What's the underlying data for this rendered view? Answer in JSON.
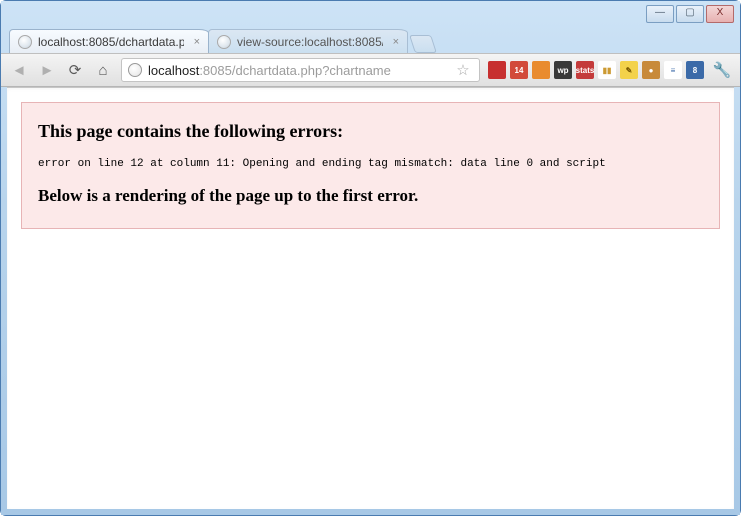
{
  "window": {
    "minimize": "—",
    "maximize": "▢",
    "close": "X"
  },
  "tabs": [
    {
      "title": "localhost:8085/dchartdata.p",
      "active": true
    },
    {
      "title": "view-source:localhost:8085/",
      "active": false
    }
  ],
  "toolbar": {
    "back": "◄",
    "forward": "►",
    "reload": "⟳",
    "home": "⌂",
    "star": "☆",
    "wrench": "🔧"
  },
  "url": {
    "host": "localhost",
    "port": ":8085",
    "path": "/dchartdata.php?chartname"
  },
  "extensions": [
    {
      "name": "ext-red-1",
      "bg": "#c73030",
      "label": ""
    },
    {
      "name": "ext-cal-14",
      "bg": "#d24a3a",
      "label": "14"
    },
    {
      "name": "ext-orange",
      "bg": "#e98b2e",
      "label": ""
    },
    {
      "name": "ext-wait",
      "bg": "#3a3a3a",
      "label": "wp"
    },
    {
      "name": "ext-stats",
      "bg": "#c43b3b",
      "label": "stats"
    },
    {
      "name": "ext-bars",
      "bg": "#ffffff",
      "label": "▮▮",
      "fg": "#cc9a33"
    },
    {
      "name": "ext-yellow",
      "bg": "#f3d24a",
      "label": "✎",
      "fg": "#7a5a00"
    },
    {
      "name": "ext-cookie",
      "bg": "#c88a3a",
      "label": "●"
    },
    {
      "name": "ext-abacus",
      "bg": "#ffffff",
      "label": "≡",
      "fg": "#3b6aa8"
    },
    {
      "name": "ext-blue-8",
      "bg": "#3b6aa8",
      "label": "8"
    }
  ],
  "error": {
    "heading": "This page contains the following errors:",
    "detail": "error on line 12 at column 11: Opening and ending tag mismatch: data line 0 and script",
    "subheading": "Below is a rendering of the page up to the first error."
  }
}
